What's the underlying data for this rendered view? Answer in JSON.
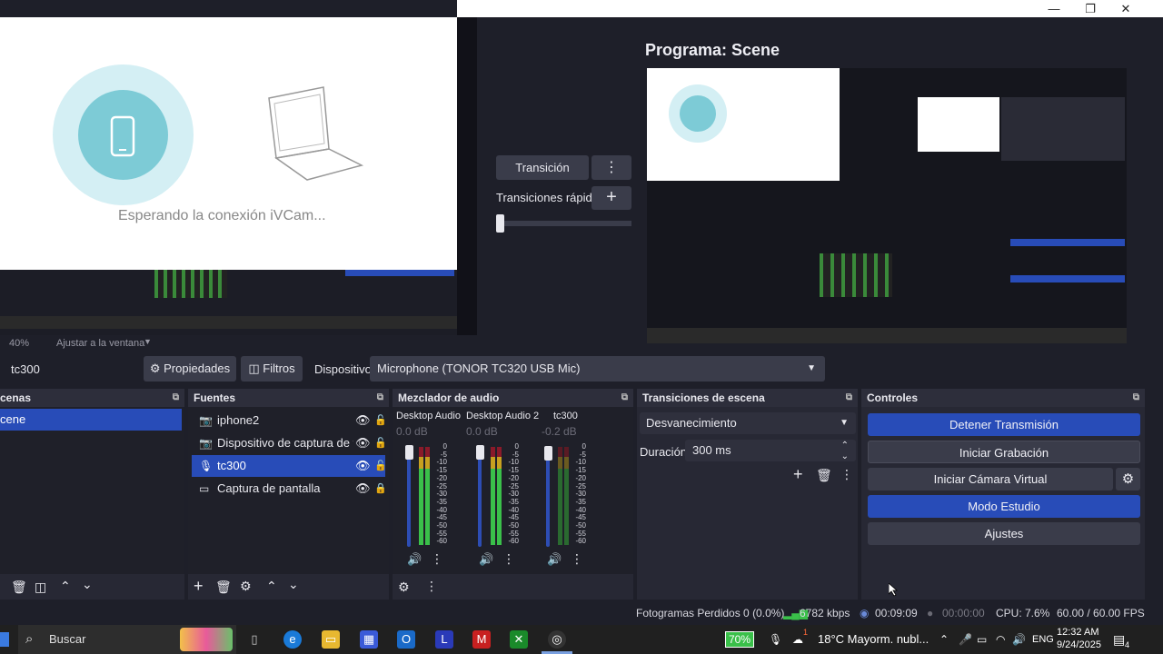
{
  "window": {
    "minimize": "—",
    "restore": "❐",
    "close": "✕"
  },
  "preview": {
    "waiting_text": "Esperando la conexión iVCam...",
    "zoom": "40%",
    "fit_label": "Ajustar a la ventana"
  },
  "transition_controls": {
    "transition_label": "Transición",
    "menu_icon": "⋮",
    "quick_label": "Transiciones rápidas",
    "add_icon": "+"
  },
  "program": {
    "title": "Programa: Scene"
  },
  "source_toolbar": {
    "selected_source": "tc300",
    "properties_label": "Propiedades",
    "filters_label": "Filtros",
    "device_label": "Dispositivo",
    "device_value": "Microphone (TONOR TC320 USB Mic)"
  },
  "scenes": {
    "title": "cenas",
    "items": [
      "cene"
    ]
  },
  "sources": {
    "title": "Fuentes",
    "items": [
      {
        "name": "iphone2",
        "icon": "camera-icon"
      },
      {
        "name": "Dispositivo de captura de vid",
        "icon": "camera-icon"
      },
      {
        "name": "tc300",
        "icon": "microphone-icon",
        "selected": true
      },
      {
        "name": "Captura de pantalla",
        "icon": "monitor-icon"
      }
    ]
  },
  "mixer": {
    "title": "Mezclador de audio",
    "channels": [
      {
        "name": "Desktop Audio",
        "db": "0.0 dB"
      },
      {
        "name": "Desktop Audio 2",
        "db": "0.0 dB"
      },
      {
        "name": "tc300",
        "db": "-0.2 dB"
      }
    ],
    "scale": [
      "0",
      "-5",
      "-10",
      "-15",
      "-20",
      "-25",
      "-30",
      "-35",
      "-40",
      "-45",
      "-50",
      "-55",
      "-60"
    ]
  },
  "transitions": {
    "title": "Transiciones de escena",
    "selected": "Desvanecimiento",
    "duration_label": "Duración",
    "duration_value": "300 ms"
  },
  "controls": {
    "title": "Controles",
    "stop_stream": "Detener Transmisión",
    "start_recording": "Iniciar Grabación",
    "start_virtual_cam": "Iniciar Cámara Virtual",
    "studio_mode": "Modo Estudio",
    "settings": "Ajustes"
  },
  "status": {
    "dropped_frames": "Fotogramas Perdidos 0 (0.0%)",
    "bitrate": "6782 kbps",
    "stream_time": "00:09:09",
    "record_time": "00:00:00",
    "cpu": "CPU: 7.6%",
    "fps": "60.00 / 60.00 FPS"
  },
  "taskbar": {
    "search_placeholder": "Buscar",
    "battery": "70%",
    "weather_badge": "1",
    "weather": "18°C  Mayorm. nubl...",
    "language": "ENG",
    "time": "12:32 AM",
    "date": "9/24/2025",
    "notification_count": "4"
  },
  "colors": {
    "accent": "#284cb8",
    "panel": "#272834",
    "background": "#1e1f29"
  }
}
